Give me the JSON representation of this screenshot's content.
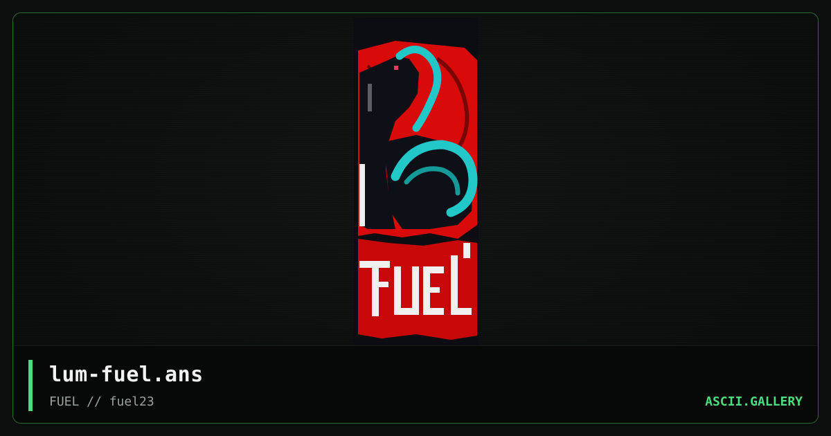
{
  "card": {
    "filename": "lum-fuel.ans",
    "meta": "FUEL // fuel23",
    "brand": "ASCII.GALLERY"
  },
  "artwork": {
    "lettering": "FUEL"
  },
  "colors": {
    "accent": "#4ade80",
    "border": "#2f6a35",
    "art_red": "#d80a0a",
    "art_cyan": "#22c8c8",
    "art_dark": "#0d1016",
    "art_white": "#f0f0f0"
  }
}
